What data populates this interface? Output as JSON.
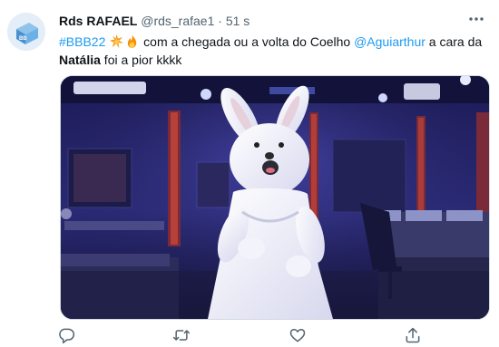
{
  "tweet": {
    "display_name": "Rds RAFAEL",
    "handle": "@rds_rafae1",
    "separator": "·",
    "time": "51 s",
    "text_parts": {
      "hashtag": "#BBB22",
      "body1": " com a chegada ou a volta do Coelho ",
      "mention": "@Aguiarthur",
      "body2": " a cara da",
      "bold_name": "Natália",
      "body3": " foi a pior kkkk"
    },
    "emojis": [
      "collision-emoji",
      "fire-emoji"
    ],
    "media_alt": "Pessoa em fantasia de coelho branco em um quarto iluminado em azul"
  },
  "icons": {
    "more": "more-icon",
    "reply": "reply-icon",
    "retweet": "retweet-icon",
    "like": "like-icon",
    "share": "share-icon"
  },
  "colors": {
    "link": "#1d9bf0",
    "secondary_text": "#536471",
    "primary_text": "#0f1419"
  }
}
